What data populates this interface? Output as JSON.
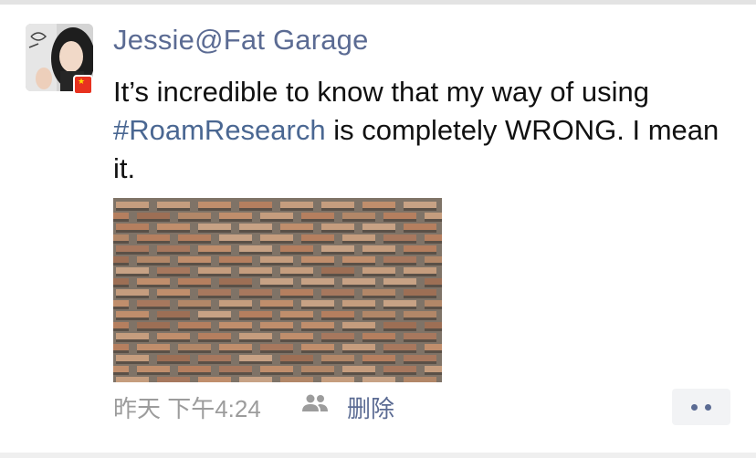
{
  "post": {
    "author": "Jessie@Fat Garage",
    "text_before": "It’s incredible to know that my way of using ",
    "hashtag": "#RoamResearch",
    "text_after": " is completely WRONG. I mean it.",
    "timestamp": "昨天 下午4:24",
    "delete_label": "删除"
  },
  "icons": {
    "avatar": "profile-photo",
    "flag": "china-flag-icon",
    "visibility": "friends-icon",
    "more": "more-dots-icon"
  },
  "colors": {
    "name": "#5b6b93",
    "hashtag": "#4a6792",
    "timestamp": "#9c9c9c",
    "more_button_bg": "#f2f3f5"
  }
}
